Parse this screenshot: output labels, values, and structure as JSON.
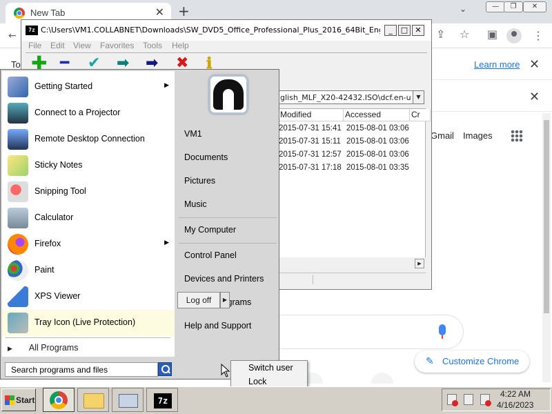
{
  "chrome": {
    "tab_title": "New Tab",
    "tab_close": "✕",
    "new_tab": "+",
    "learn_more": "Learn more",
    "close_glyph": "✕",
    "gmail": "Gmail",
    "images": "Images",
    "customize": "Customize Chrome",
    "partial_left_text": "To"
  },
  "sevenzip": {
    "title_path": "C:\\Users\\VM1.COLLABNET\\Downloads\\SW_DVD5_Office_Professional_Plus_2016_64Bit_Engli...",
    "logo": "7z",
    "menu": [
      "File",
      "Edit",
      "View",
      "Favorites",
      "Tools",
      "Help"
    ],
    "address": "glish_MLF_X20-42432.ISO\\dcf.en-us\\",
    "columns": [
      "Modified",
      "Accessed",
      "Cr"
    ],
    "rows": [
      {
        "modified": "2015-07-31 15:41",
        "accessed": "2015-08-01 03:06"
      },
      {
        "modified": "2015-07-31 15:11",
        "accessed": "2015-08-01 03:06"
      },
      {
        "modified": "2015-07-31 12:57",
        "accessed": "2015-08-01 03:06"
      },
      {
        "modified": "2015-07-31 17:18",
        "accessed": "2015-08-01 03:35"
      }
    ]
  },
  "startmenu": {
    "programs": [
      {
        "label": "Getting Started",
        "arrow": "▶"
      },
      {
        "label": "Connect to a Projector"
      },
      {
        "label": "Remote Desktop Connection"
      },
      {
        "label": "Sticky Notes"
      },
      {
        "label": "Snipping Tool"
      },
      {
        "label": "Calculator"
      },
      {
        "label": "Firefox",
        "arrow": "▶"
      },
      {
        "label": "Paint"
      },
      {
        "label": "XPS Viewer"
      },
      {
        "label": "Tray Icon (Live Protection)"
      }
    ],
    "all_programs": "All Programs",
    "all_programs_arrow": "▶",
    "search_placeholder": "Search programs and files",
    "right": {
      "user": "VM1",
      "documents": "Documents",
      "pictures": "Pictures",
      "music": "Music",
      "computer": "My Computer",
      "control_panel": "Control Panel",
      "devices": "Devices and Printers",
      "default_programs": "Default Programs",
      "help": "Help and Support"
    },
    "logoff": "Log off",
    "logoff_arrow": "▶",
    "context": {
      "switch_user": "Switch user",
      "lock": "Lock"
    }
  },
  "taskbar": {
    "start": "Start",
    "time": "4:22 AM",
    "date": "4/16/2023",
    "sevenzip_label": "7z"
  }
}
